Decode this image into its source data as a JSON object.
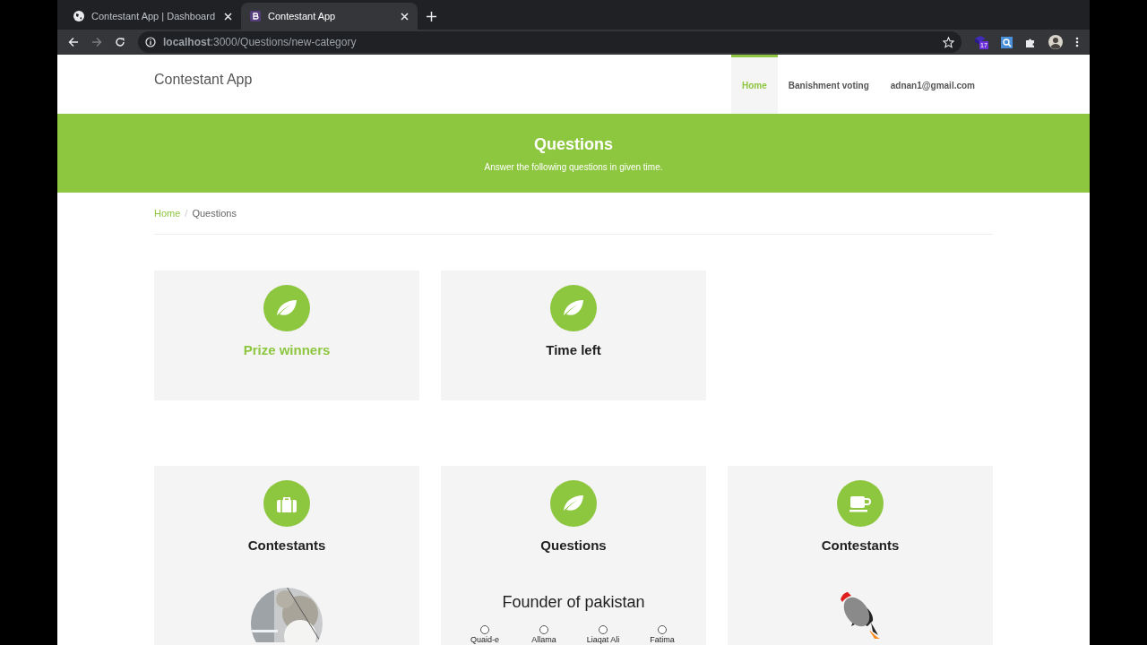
{
  "browser": {
    "tabs": [
      {
        "kind": "globe",
        "title": "Contestant App | Dashboard",
        "selected": false
      },
      {
        "kind": "bootstrap",
        "title": "Contestant App",
        "selected": true
      }
    ],
    "url": "**localhost**:3000/Questions/new-category",
    "extension_badge": "17"
  },
  "navbar": {
    "brand": "Contestant App",
    "items": [
      {
        "label": "Home",
        "selected": true
      },
      {
        "label": "Banishment voting",
        "selected": false
      },
      {
        "label": "adnan1@gmail.com",
        "selected": false
      }
    ]
  },
  "banner": {
    "title": "Questions",
    "subtitle": "Answer the following questions in given time."
  },
  "breadcrumb": [
    {
      "label": "Home",
      "kind": "link",
      "separator": "/"
    },
    {
      "label": "Questions",
      "kind": "current"
    }
  ],
  "card_rows": [
    [
      {
        "kind": "leaf",
        "title": "Prize winners",
        "highlighted": true
      },
      {
        "kind": "leaf",
        "title": "Time left",
        "highlighted": false
      }
    ],
    [
      {
        "kind": "briefcase",
        "title": "Contestants",
        "highlighted": false
      },
      {
        "kind": "leaf",
        "title": "Questions",
        "highlighted": false,
        "content": {
          "kind": "question",
          "question": "Founder of pakistan",
          "options": [
            {
              "label": "Quaid-e",
              "selected": false
            },
            {
              "label": "Allama",
              "selected": false
            },
            {
              "label": "Liaqat Ali",
              "selected": false
            },
            {
              "label": "Fatima",
              "selected": false
            }
          ]
        }
      },
      {
        "kind": "cup",
        "title": "Contestants",
        "highlighted": false,
        "content": {
          "kind": "rocket"
        }
      }
    ]
  ]
}
